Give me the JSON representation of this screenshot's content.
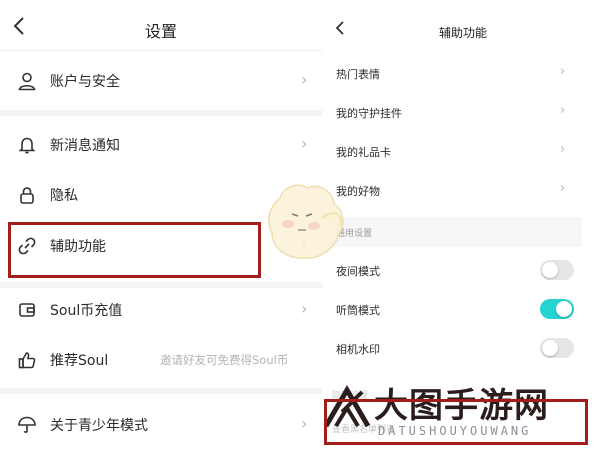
{
  "left_screen": {
    "title": "设置",
    "back_icon": "chevron-left-icon",
    "items": [
      {
        "label": "账户与安全",
        "icon": "user-icon"
      },
      {
        "label": "新消息通知",
        "icon": "bell-icon"
      },
      {
        "label": "隐私",
        "icon": "lock-icon"
      },
      {
        "label": "辅助功能",
        "icon": "link-icon"
      },
      {
        "label": "Soul币充值",
        "icon": "wallet-icon"
      },
      {
        "label": "推荐Soul",
        "icon": "thumbs-up-icon",
        "hint": "邀请好友可免费得Soul币"
      },
      {
        "label": "关于青少年模式",
        "icon": "umbrella-icon"
      }
    ]
  },
  "right_screen": {
    "title": "辅助功能",
    "back_icon": "chevron-left-icon",
    "items": [
      {
        "label": "热门表情"
      },
      {
        "label": "我的守护挂件"
      },
      {
        "label": "我的礼品卡"
      },
      {
        "label": "我的好物"
      }
    ],
    "section_label": "通用设置",
    "toggles": [
      {
        "label": "夜间模式",
        "on": false
      },
      {
        "label": "听筒模式",
        "on": true
      },
      {
        "label": "相机水印",
        "on": false
      }
    ],
    "section2_label": "隐私设置",
    "last_item_label": "查看黑名单列表"
  },
  "watermark": {
    "chinese": "大图手游网",
    "english": "DATUSHOUYOUWANG"
  },
  "colors": {
    "highlight_border": "#a31d1d",
    "toggle_on": "#25d4d0",
    "toggle_off": "#e6e6e6"
  }
}
